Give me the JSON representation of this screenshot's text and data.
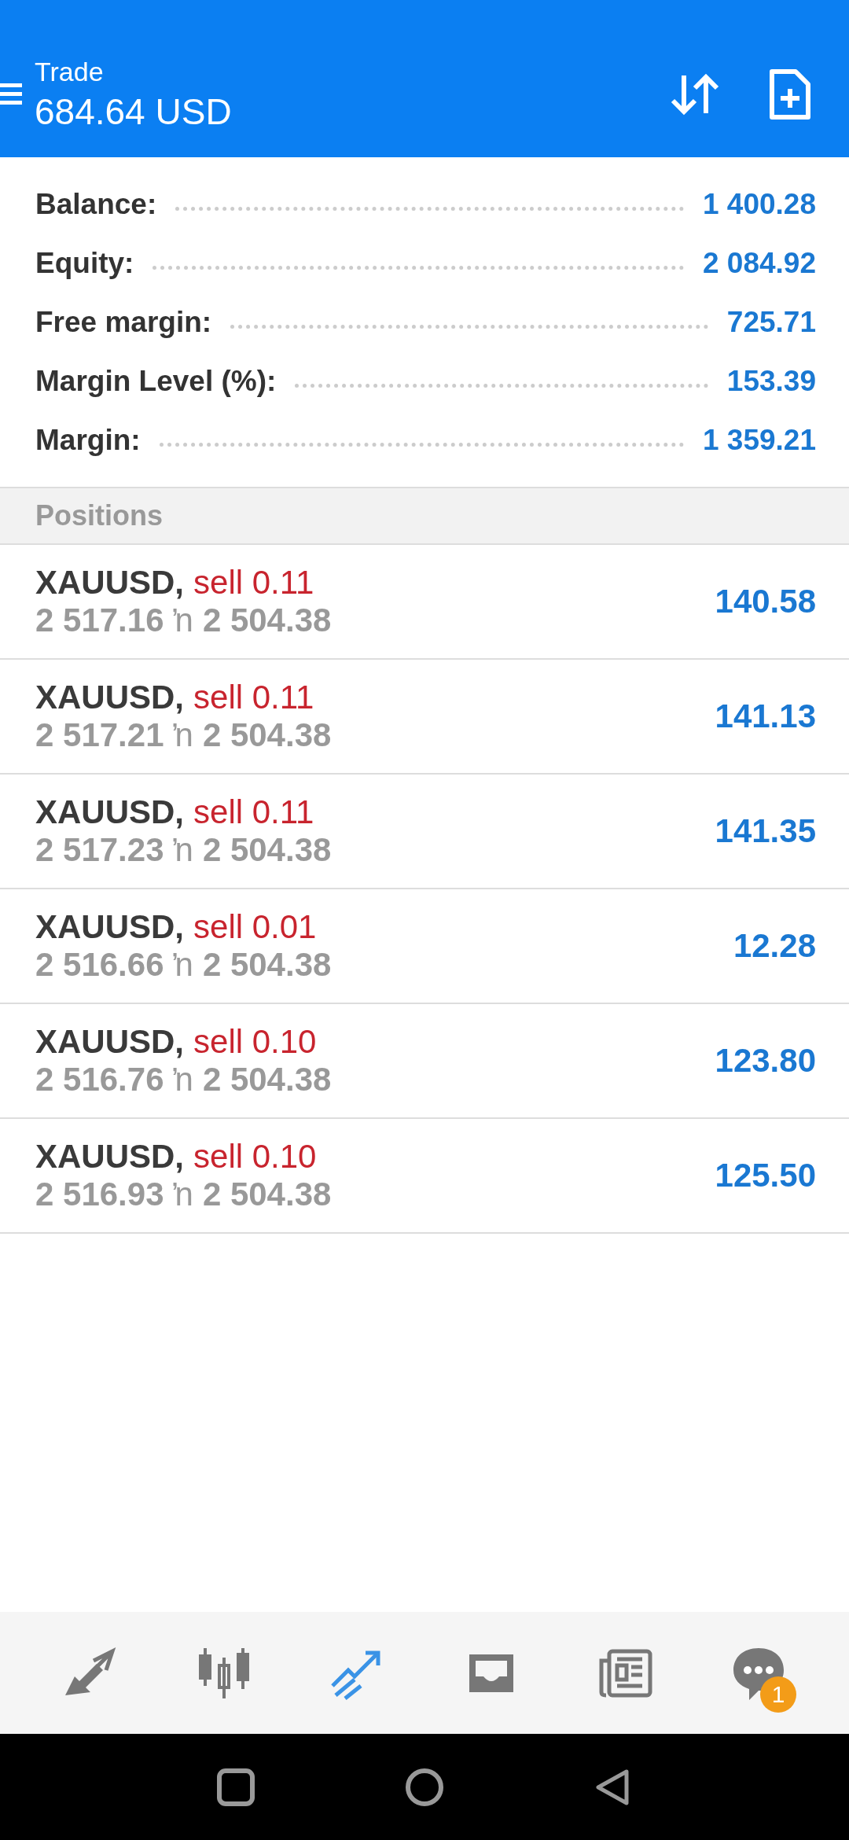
{
  "header": {
    "title": "Trade",
    "subtitle": "684.64 USD"
  },
  "summary": [
    {
      "label": "Balance:",
      "value": "1 400.28"
    },
    {
      "label": "Equity:",
      "value": "2 084.92"
    },
    {
      "label": "Free margin:",
      "value": "725.71"
    },
    {
      "label": "Margin Level (%):",
      "value": "153.39"
    },
    {
      "label": "Margin:",
      "value": "1 359.21"
    }
  ],
  "positions": {
    "heading": "Positions",
    "rows": [
      {
        "symbol": "XAUUSD,",
        "side": "sell 0.11",
        "open": "2 517.16",
        "arrow": "ŉ",
        "current": "2 504.38",
        "profit": "140.58"
      },
      {
        "symbol": "XAUUSD,",
        "side": "sell 0.11",
        "open": "2 517.21",
        "arrow": "ŉ",
        "current": "2 504.38",
        "profit": "141.13"
      },
      {
        "symbol": "XAUUSD,",
        "side": "sell 0.11",
        "open": "2 517.23",
        "arrow": "ŉ",
        "current": "2 504.38",
        "profit": "141.35"
      },
      {
        "symbol": "XAUUSD,",
        "side": "sell 0.01",
        "open": "2 516.66",
        "arrow": "ŉ",
        "current": "2 504.38",
        "profit": "12.28"
      },
      {
        "symbol": "XAUUSD,",
        "side": "sell 0.10",
        "open": "2 516.76",
        "arrow": "ŉ",
        "current": "2 504.38",
        "profit": "123.80"
      },
      {
        "symbol": "XAUUSD,",
        "side": "sell 0.10",
        "open": "2 516.93",
        "arrow": "ŉ",
        "current": "2 504.38",
        "profit": "125.50"
      }
    ]
  },
  "nav": [
    {
      "kind": "quotes",
      "selected": false
    },
    {
      "kind": "chart",
      "selected": false
    },
    {
      "kind": "trade",
      "selected": true
    },
    {
      "kind": "history",
      "selected": false
    },
    {
      "kind": "news",
      "selected": false
    },
    {
      "kind": "chat",
      "selected": false,
      "badge": "1"
    }
  ]
}
